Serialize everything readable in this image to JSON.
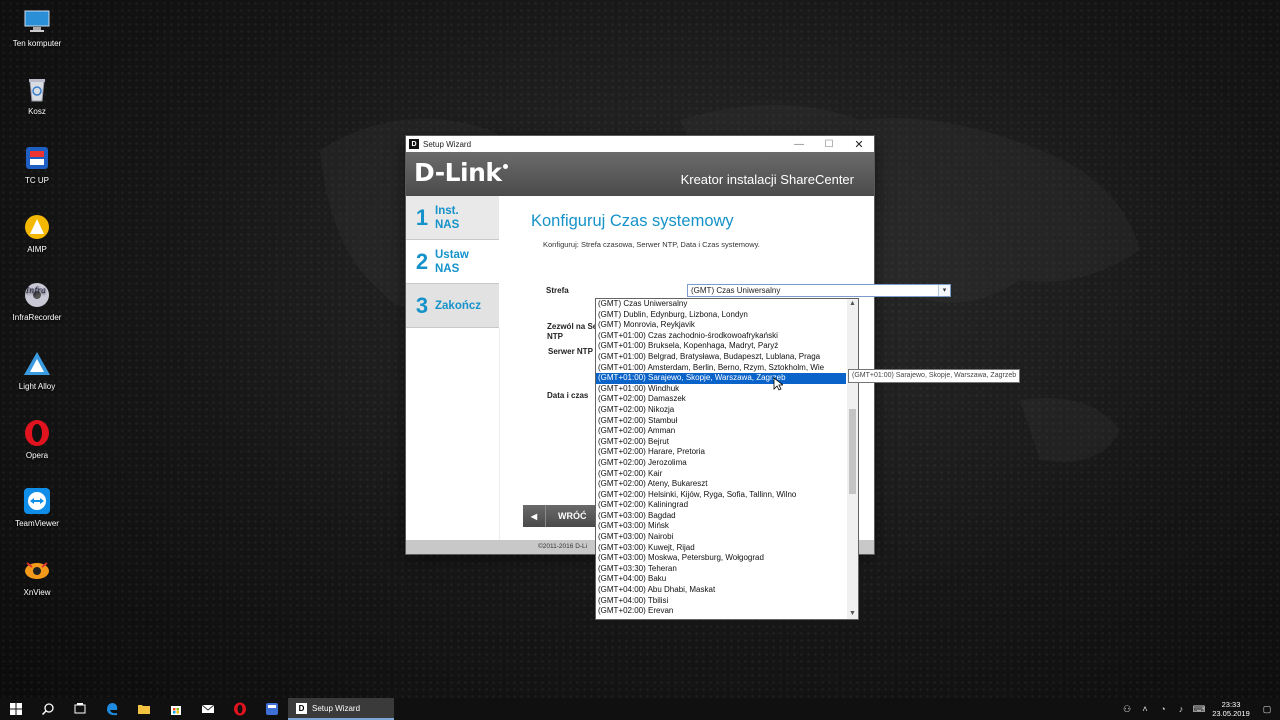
{
  "desktop": {
    "icons": [
      {
        "label": "Ten komputer",
        "icon": "computer-icon"
      },
      {
        "label": "Kosz",
        "icon": "recycle-bin-icon"
      },
      {
        "label": "TC UP",
        "icon": "tc-up-icon"
      },
      {
        "label": "AIMP",
        "icon": "aimp-icon"
      },
      {
        "label": "InfraRecorder",
        "icon": "infrarecorder-icon"
      },
      {
        "label": "Light Alloy",
        "icon": "light-alloy-icon"
      },
      {
        "label": "Opera",
        "icon": "opera-icon"
      },
      {
        "label": "TeamViewer",
        "icon": "teamviewer-icon"
      },
      {
        "label": "XnView",
        "icon": "xnview-icon"
      }
    ]
  },
  "window": {
    "title": "Setup Wizard",
    "brand": "D-Link",
    "banner_title": "Kreator instalacji ShareCenter",
    "controls": {
      "minimize": "—",
      "maximize": "☐",
      "close": "✕"
    }
  },
  "steps": [
    {
      "num": "1",
      "line1": "Inst.",
      "line2": "NAS"
    },
    {
      "num": "2",
      "line1": "Ustaw",
      "line2": "NAS"
    },
    {
      "num": "3",
      "line1": "Zakończ",
      "line2": ""
    }
  ],
  "page": {
    "heading": "Konfiguruj Czas systemowy",
    "subtitle": "Konfiguruj: Strefa czasowa, Serwer NTP, Data i Czas systemowy.",
    "labels": {
      "strefa": "Strefa",
      "zezwol": "Zezwól na Se",
      "ntp": "NTP",
      "serwer_ntp": "Serwer NTP",
      "data_czas": "Data i czas"
    },
    "timezone_selected": "(GMT) Czas Uniwersalny",
    "back_button": "WRÓĆ",
    "footer": "©2011-2016 D-Li"
  },
  "dropdown": {
    "selected_index": 7,
    "options": [
      "(GMT) Czas Uniwersalny",
      "(GMT) Dublin, Edynburg, Lizbona, Londyn",
      "(GMT) Monrovia, Reykjavik",
      "(GMT+01:00) Czas zachodnio-środkowoafrykański",
      "(GMT+01:00) Bruksela, Kopenhaga, Madryt, Paryż",
      "(GMT+01:00) Belgrad, Bratysława, Budapeszt, Lublana, Praga",
      "(GMT+01:00) Amsterdam, Berlin, Berno, Rzym, Sztokholm, Wie",
      "(GMT+01:00) Sarajewo, Skopje, Warszawa, Zagrzeb",
      "(GMT+01:00) Windhuk",
      "(GMT+02:00) Damaszek",
      "(GMT+02:00) Nikozja",
      "(GMT+02:00) Stambuł",
      "(GMT+02:00) Amman",
      "(GMT+02:00) Bejrut",
      "(GMT+02:00) Harare, Pretoria",
      "(GMT+02:00) Jerozolima",
      "(GMT+02:00) Kair",
      "(GMT+02:00) Ateny, Bukareszt",
      "(GMT+02:00) Helsinki, Kijów, Ryga, Sofia, Tallinn, Wilno",
      "(GMT+02:00) Kaliningrad",
      "(GMT+03:00) Bagdad",
      "(GMT+03:00) Mińsk",
      "(GMT+03:00) Nairobi",
      "(GMT+03:00) Kuwejt, Rijad",
      "(GMT+03:00) Moskwa, Petersburg, Wołgograd",
      "(GMT+03:30) Teheran",
      "(GMT+04:00) Baku",
      "(GMT+04:00) Abu Dhabi, Maskat",
      "(GMT+04:00) Tbilisi",
      "(GMT+02:00) Erevan"
    ],
    "tooltip": "(GMT+01:00) Sarajewo, Skopje, Warszawa, Zagrzeb"
  },
  "taskbar": {
    "active_app": "Setup Wizard",
    "time": "23:33",
    "date": "23.05.2019"
  },
  "colors": {
    "accent": "#1592c9",
    "selection": "#0a63c9",
    "banner": "#5a5a5a"
  }
}
